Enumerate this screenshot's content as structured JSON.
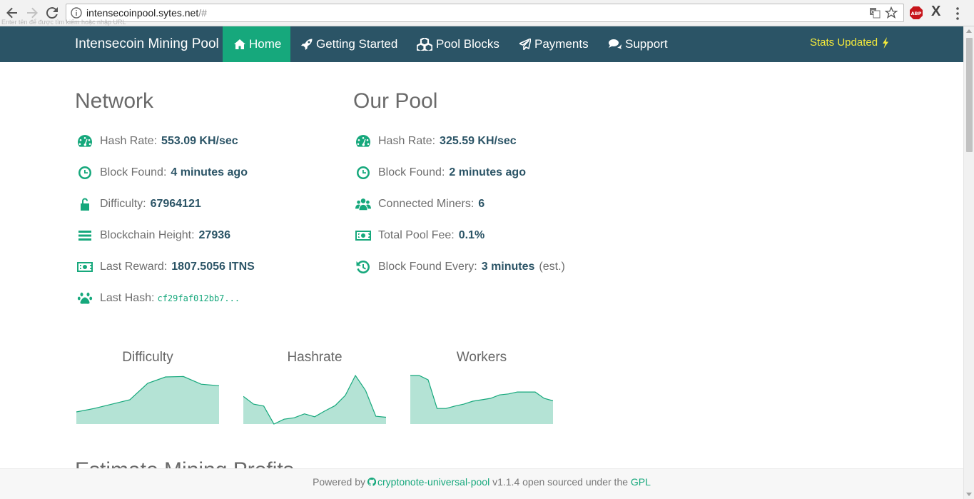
{
  "browser": {
    "url_host": "intensecoinpool.sytes.net",
    "url_path": "/#",
    "tooltip": "Enter tên để được tìm kiếm hoặc nhập URL"
  },
  "navbar": {
    "brand": "Intensecoin Mining Pool",
    "items": [
      {
        "label": "Home",
        "icon": "home-icon",
        "active": true
      },
      {
        "label": "Getting Started",
        "icon": "rocket-icon"
      },
      {
        "label": "Pool Blocks",
        "icon": "cubes-icon"
      },
      {
        "label": "Payments",
        "icon": "paper-plane-icon"
      },
      {
        "label": "Support",
        "icon": "comments-icon"
      }
    ],
    "stats_updated": "Stats Updated"
  },
  "network": {
    "title": "Network",
    "hash_rate": {
      "label": "Hash Rate:",
      "value": "553.09 KH/sec"
    },
    "block_found": {
      "label": "Block Found:",
      "value": "4 minutes ago"
    },
    "difficulty": {
      "label": "Difficulty:",
      "value": "67964121"
    },
    "blockchain_height": {
      "label": "Blockchain Height:",
      "value": "27936"
    },
    "last_reward": {
      "label": "Last Reward:",
      "value": "1807.5056 ITNS"
    },
    "last_hash": {
      "label": "Last Hash:",
      "value": "cf29faf012bb7..."
    }
  },
  "pool": {
    "title": "Our Pool",
    "hash_rate": {
      "label": "Hash Rate:",
      "value": "325.59 KH/sec"
    },
    "block_found": {
      "label": "Block Found:",
      "value": "2 minutes ago"
    },
    "connected_miners": {
      "label": "Connected Miners:",
      "value": "6"
    },
    "total_fee": {
      "label": "Total Pool Fee:",
      "value": "0.1%"
    },
    "block_every": {
      "label": "Block Found Every:",
      "value": "3 minutes",
      "suffix": "(est.)"
    }
  },
  "charts": {
    "difficulty": {
      "title": "Difficulty",
      "values": [
        0.25,
        0.32,
        0.41,
        0.5,
        0.84,
        0.97,
        0.98,
        0.82,
        0.79
      ]
    },
    "hashrate": {
      "title": "Hashrate",
      "values": [
        0.57,
        0.41,
        0.37,
        0.0,
        0.1,
        0.13,
        0.21,
        0.15,
        0.27,
        0.38,
        0.59,
        1.0,
        0.69,
        0.16,
        0.14
      ]
    },
    "workers": {
      "title": "Workers",
      "values": [
        1.0,
        1.0,
        0.91,
        0.32,
        0.32,
        0.37,
        0.41,
        0.47,
        0.5,
        0.53,
        0.6,
        0.62,
        0.66,
        0.66,
        0.66,
        0.53,
        0.48
      ]
    }
  },
  "colors": {
    "accent": "#16a87c",
    "navbar": "#2b5466",
    "chart_fill": "#b4e3d5",
    "stats_updated": "#f4ea3b"
  },
  "next_section": "Estimate Mining Profits",
  "footer": {
    "powered_by": "Powered by",
    "project": "cryptonote-universal-pool",
    "version_text": "v1.1.4 open sourced under the",
    "license": "GPL"
  }
}
